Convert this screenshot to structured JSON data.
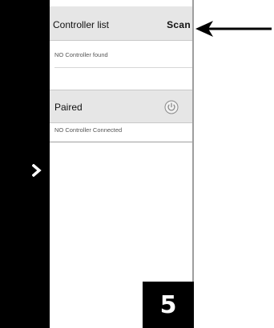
{
  "side_nav": {
    "expand_icon": "chevron-right-icon"
  },
  "controller_list": {
    "title": "Controller list",
    "scan_label": "Scan",
    "empty_text": "NO Controller found"
  },
  "paired": {
    "title": "Paired",
    "power_icon": "power-icon",
    "empty_text": "NO Controller Connected"
  },
  "annotation": {
    "arrow_icon": "arrow-left-icon",
    "step_number": "5"
  },
  "colors": {
    "header_bg": "#e6e6e6",
    "sidebar_bg": "#000000",
    "badge_bg": "#000000"
  }
}
